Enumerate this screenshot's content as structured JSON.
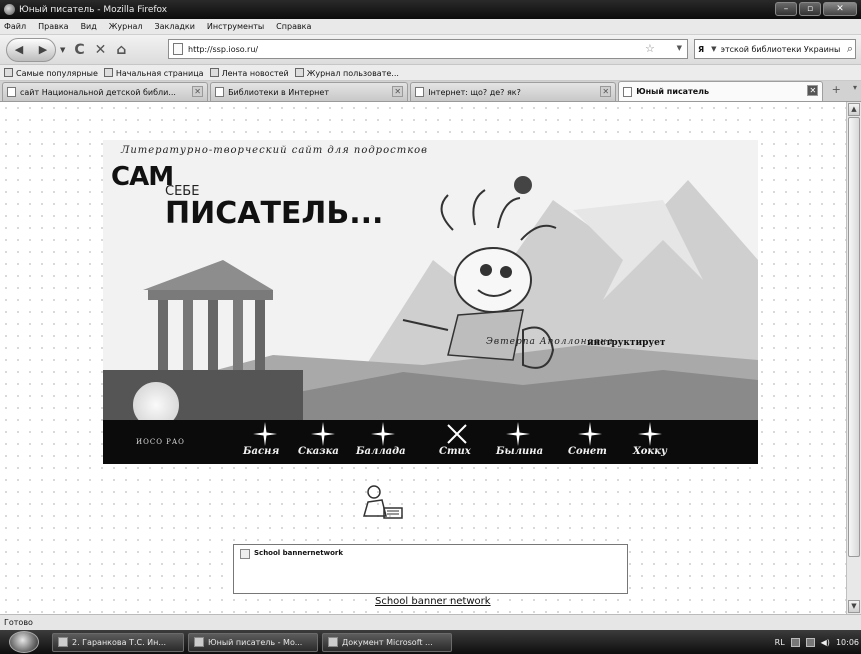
{
  "window": {
    "title": "Юный писатель - Mozilla Firefox",
    "buttons": {
      "minimize": "–",
      "maximize": "▫",
      "close": "✕"
    }
  },
  "menu": [
    "Файл",
    "Правка",
    "Вид",
    "Журнал",
    "Закладки",
    "Инструменты",
    "Справка"
  ],
  "navbar": {
    "back": "◀",
    "forward": "▶",
    "reload": "C",
    "stop": "✕",
    "home": "⌂",
    "url": "http://ssp.ioso.ru/",
    "search_engine": "Я",
    "search_value": "этской библиотеки Украины"
  },
  "bookmarks": [
    "Самые популярные",
    "Начальная страница",
    "Лента новостей",
    "Журнал пользовате..."
  ],
  "tabs": [
    {
      "label": "сайт Национальной детской библи...",
      "active": false
    },
    {
      "label": "Библиотеки в Интернет",
      "active": false
    },
    {
      "label": "Інтернет: що? де? як?",
      "active": false
    },
    {
      "label": "Юный писатель",
      "active": true
    }
  ],
  "new_tab": "+",
  "page": {
    "tagline": "Литературно-творческий сайт для подростков",
    "logo_line1": "САМ",
    "logo_line2": "СЕБЕ",
    "logo_line3": "ПИСАТЕЛЬ...",
    "caption_italic": "Эвтерпа Аполлоновна",
    "caption_bold": "инструктирует",
    "org": "ИОСО РАО",
    "genres": [
      "Басня",
      "Сказка",
      "Баллада",
      "Стих",
      "Былина",
      "Сонет",
      "Хокку"
    ],
    "banner_box_text": "School bannernetwork",
    "banner_link": "School banner network"
  },
  "status": "Готово",
  "taskbar": {
    "tasks": [
      "2. Гаранкова Т.С. Ин...",
      "Юный писатель - Mo...",
      "Документ Microsoft ..."
    ],
    "lang": "RL",
    "clock": "10:06"
  }
}
